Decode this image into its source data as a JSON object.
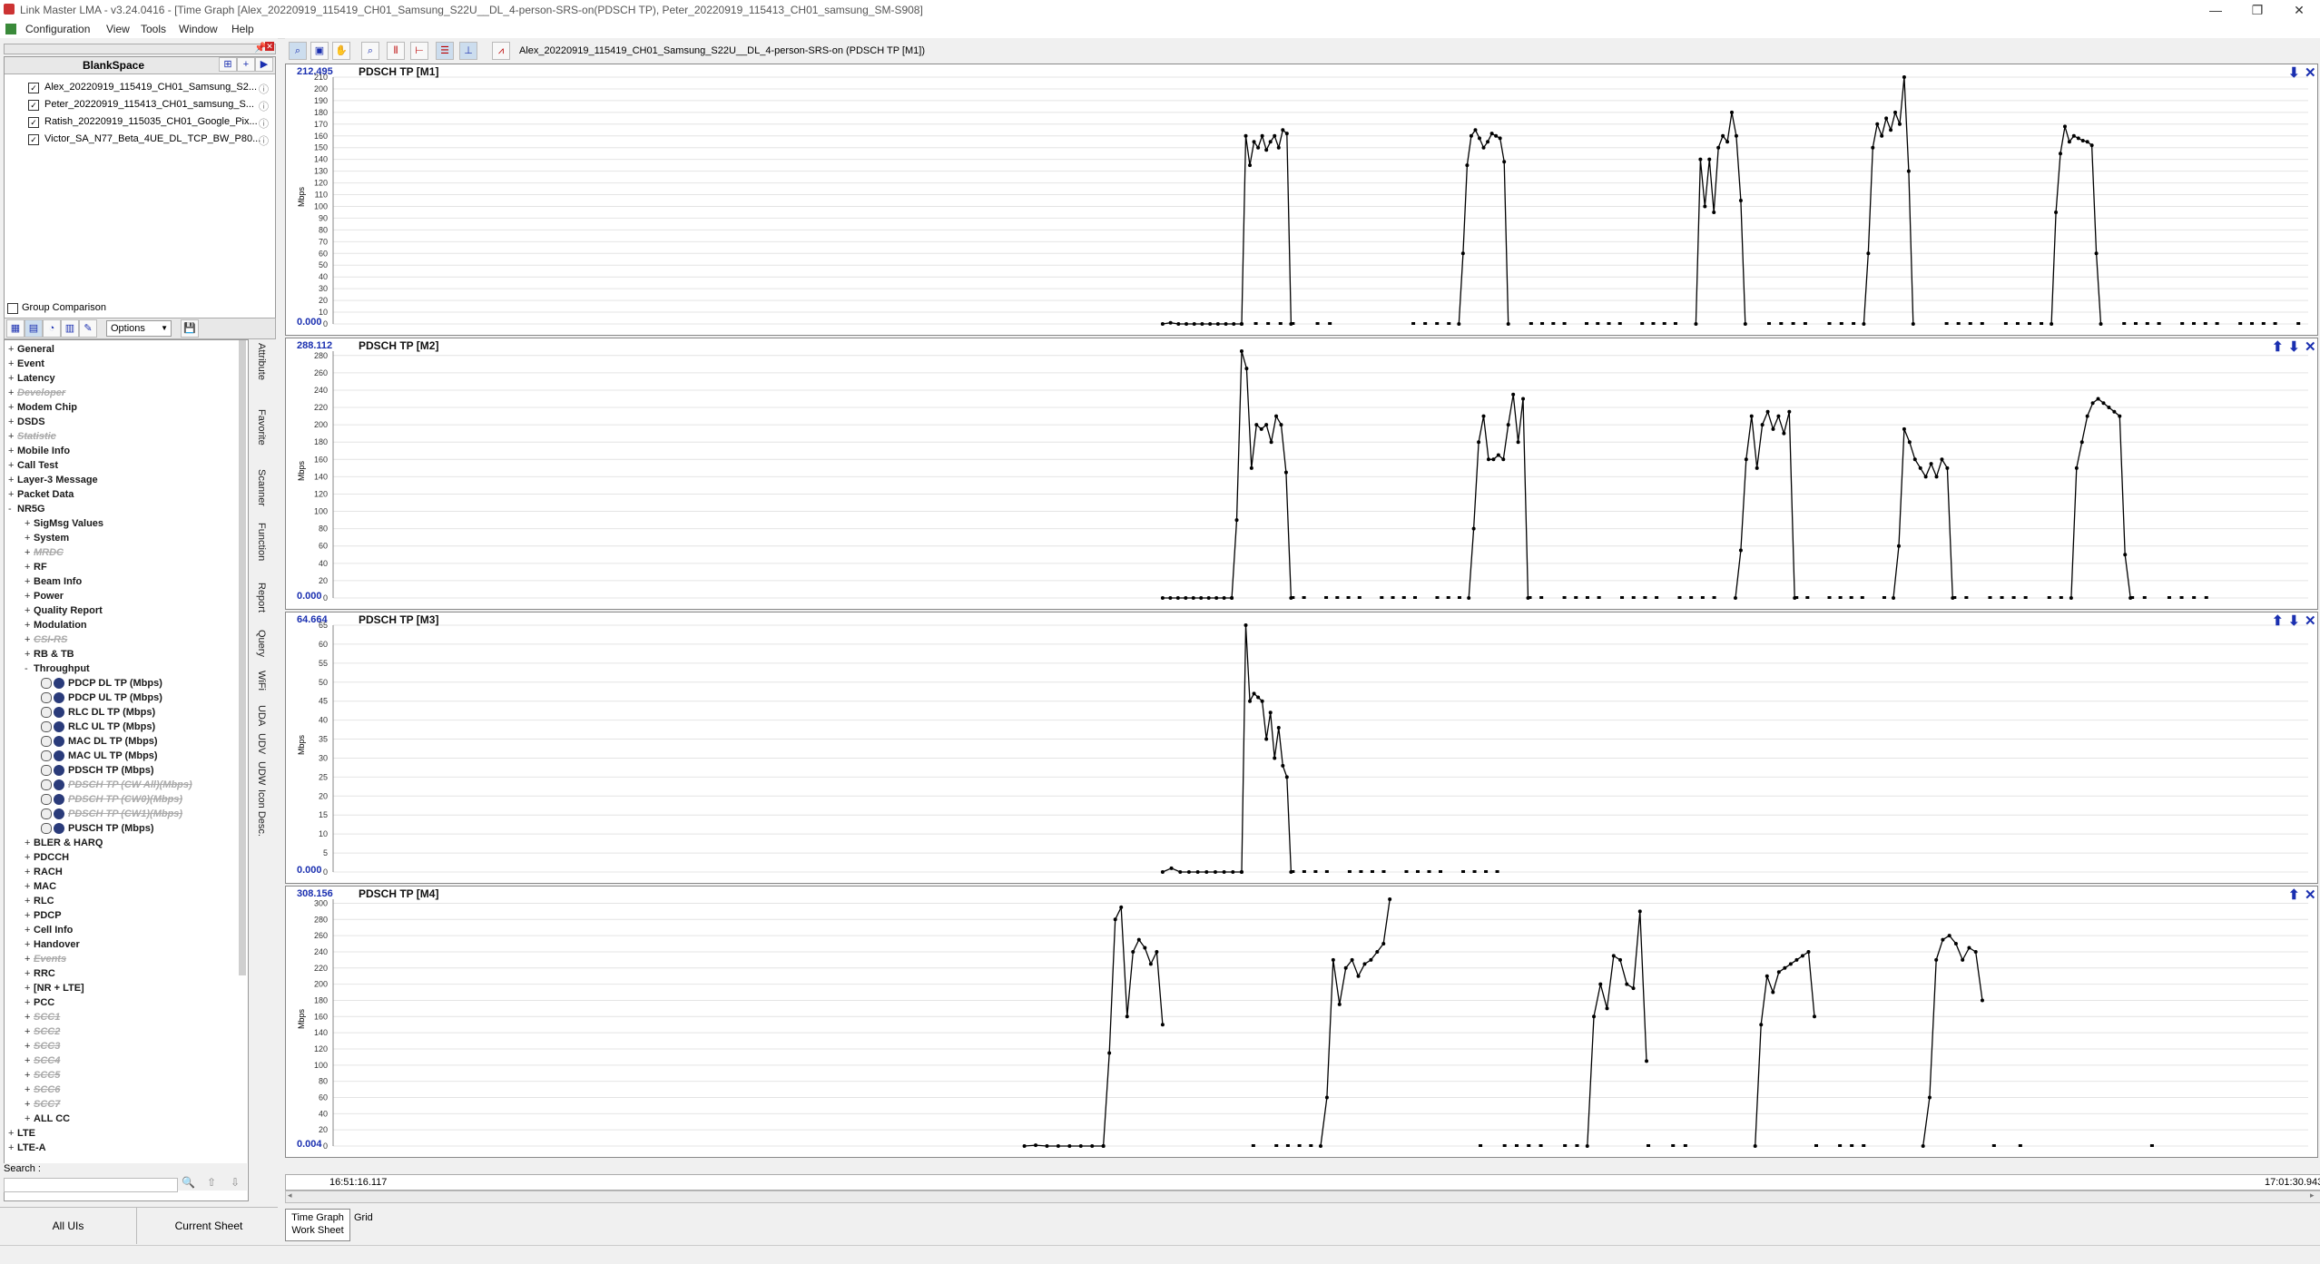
{
  "window": {
    "title": "Link Master LMA  -  v3.24.0416 - [Time Graph [Alex_20220919_115419_CH01_Samsung_S22U__DL_4-person-SRS-on(PDSCH TP), Peter_20220919_115413_CH01_samsung_SM-S908]",
    "min": "—",
    "restore": "❐",
    "close": "✕"
  },
  "menu": [
    "Configuration",
    "View",
    "Tools",
    "Window",
    "Help"
  ],
  "left": {
    "workspace": "BlankSpace",
    "logs": [
      "Alex_20220919_115419_CH01_Samsung_S2...",
      "Peter_20220919_115413_CH01_samsung_S...",
      "Ratish_20220919_115035_CH01_Google_Pix...",
      "Victor_SA_N77_Beta_4UE_DL_TCP_BW_P80..."
    ],
    "group_comparison": "Group Comparison",
    "options_label": "Options",
    "tree": [
      {
        "label": "General",
        "level": 0,
        "exp": "+"
      },
      {
        "label": "Event",
        "level": 0,
        "exp": "+"
      },
      {
        "label": "Latency",
        "level": 0,
        "exp": "+"
      },
      {
        "label": "Developer",
        "level": 0,
        "exp": "+",
        "disabled": true
      },
      {
        "label": "Modem Chip",
        "level": 0,
        "exp": "+"
      },
      {
        "label": "DSDS",
        "level": 0,
        "exp": "+"
      },
      {
        "label": "Statistic",
        "level": 0,
        "exp": "+",
        "disabled": true
      },
      {
        "label": "Mobile Info",
        "level": 0,
        "exp": "+"
      },
      {
        "label": "Call Test",
        "level": 0,
        "exp": "+"
      },
      {
        "label": "Layer-3 Message",
        "level": 0,
        "exp": "+"
      },
      {
        "label": "Packet Data",
        "level": 0,
        "exp": "+"
      },
      {
        "label": "NR5G",
        "level": 0,
        "exp": "-"
      },
      {
        "label": "SigMsg Values",
        "level": 1,
        "exp": "+"
      },
      {
        "label": "System",
        "level": 1,
        "exp": "+"
      },
      {
        "label": "MRDC",
        "level": 1,
        "exp": "+",
        "disabled": true
      },
      {
        "label": "RF",
        "level": 1,
        "exp": "+"
      },
      {
        "label": "Beam Info",
        "level": 1,
        "exp": "+"
      },
      {
        "label": "Power",
        "level": 1,
        "exp": "+"
      },
      {
        "label": "Quality Report",
        "level": 1,
        "exp": "+"
      },
      {
        "label": "Modulation",
        "level": 1,
        "exp": "+"
      },
      {
        "label": "CSI-RS",
        "level": 1,
        "exp": "+",
        "disabled": true
      },
      {
        "label": "RB & TB",
        "level": 1,
        "exp": "+"
      },
      {
        "label": "Throughput",
        "level": 1,
        "exp": "-"
      },
      {
        "label": "PDCP DL TP (Mbps)",
        "level": 2,
        "leaf": true
      },
      {
        "label": "PDCP UL TP (Mbps)",
        "level": 2,
        "leaf": true
      },
      {
        "label": "RLC DL TP (Mbps)",
        "level": 2,
        "leaf": true
      },
      {
        "label": "RLC UL TP (Mbps)",
        "level": 2,
        "leaf": true
      },
      {
        "label": "MAC DL TP (Mbps)",
        "level": 2,
        "leaf": true
      },
      {
        "label": "MAC UL TP (Mbps)",
        "level": 2,
        "leaf": true
      },
      {
        "label": "PDSCH TP (Mbps)",
        "level": 2,
        "leaf": true
      },
      {
        "label": "PDSCH TP (CW All)(Mbps)",
        "level": 2,
        "leaf": true,
        "disabled": true
      },
      {
        "label": "PDSCH TP (CW0)(Mbps)",
        "level": 2,
        "leaf": true,
        "disabled": true
      },
      {
        "label": "PDSCH TP (CW1)(Mbps)",
        "level": 2,
        "leaf": true,
        "disabled": true
      },
      {
        "label": "PUSCH TP (Mbps)",
        "level": 2,
        "leaf": true
      },
      {
        "label": "BLER & HARQ",
        "level": 1,
        "exp": "+"
      },
      {
        "label": "PDCCH",
        "level": 1,
        "exp": "+"
      },
      {
        "label": "RACH",
        "level": 1,
        "exp": "+"
      },
      {
        "label": "MAC",
        "level": 1,
        "exp": "+"
      },
      {
        "label": "RLC",
        "level": 1,
        "exp": "+"
      },
      {
        "label": "PDCP",
        "level": 1,
        "exp": "+"
      },
      {
        "label": "Cell Info",
        "level": 1,
        "exp": "+"
      },
      {
        "label": "Handover",
        "level": 1,
        "exp": "+"
      },
      {
        "label": "Events",
        "level": 1,
        "exp": "+",
        "disabled": true
      },
      {
        "label": "RRC",
        "level": 1,
        "exp": "+"
      },
      {
        "label": "[NR + LTE]",
        "level": 1,
        "exp": "+"
      },
      {
        "label": "PCC",
        "level": 1,
        "exp": "+"
      },
      {
        "label": "SCC1",
        "level": 1,
        "exp": "+",
        "disabled": true
      },
      {
        "label": "SCC2",
        "level": 1,
        "exp": "+",
        "disabled": true
      },
      {
        "label": "SCC3",
        "level": 1,
        "exp": "+",
        "disabled": true
      },
      {
        "label": "SCC4",
        "level": 1,
        "exp": "+",
        "disabled": true
      },
      {
        "label": "SCC5",
        "level": 1,
        "exp": "+",
        "disabled": true
      },
      {
        "label": "SCC6",
        "level": 1,
        "exp": "+",
        "disabled": true
      },
      {
        "label": "SCC7",
        "level": 1,
        "exp": "+",
        "disabled": true
      },
      {
        "label": "ALL CC",
        "level": 1,
        "exp": "+"
      },
      {
        "label": "LTE",
        "level": 0,
        "exp": "+"
      },
      {
        "label": "LTE-A",
        "level": 0,
        "exp": "+"
      }
    ],
    "side_tabs": [
      "Attribute",
      "Favorite",
      "Scanner",
      "Function",
      "Report",
      "Query",
      "WiFi",
      "UDA",
      "UDV",
      "UDW",
      "Icon Desc."
    ],
    "search_label": "Search :",
    "bottom_tabs": [
      "All UIs",
      "Current Sheet"
    ]
  },
  "graph": {
    "toolbar_title": "Alex_20220919_115419_CH01_Samsung_S22U__DL_4-person-SRS-on (PDSCH TP [M1])",
    "panels": [
      {
        "title": "PDSCH TP [M1]",
        "max": "212.495",
        "min": "0.000",
        "ticks": [
          210,
          200,
          190,
          180,
          170,
          160,
          150,
          140,
          130,
          120,
          110,
          100,
          90,
          80,
          70,
          60,
          50,
          40,
          30,
          20,
          10,
          0
        ],
        "ymax": 210,
        "unit": "Mbps",
        "ctrl": [
          "⬇",
          "✕"
        ],
        "segments": [
          {
            "x0": 0.42,
            "x1": 0.46,
            "pts": [
              0,
              1,
              0,
              0,
              0,
              0,
              0,
              0,
              0,
              0,
              0
            ]
          },
          {
            "x0": 0.46,
            "x1": 0.485,
            "pts": [
              0,
              160,
              135,
              155,
              150,
              160,
              148,
              155,
              160,
              150,
              165,
              162,
              0
            ]
          },
          {
            "x0": 0.57,
            "x1": 0.595,
            "pts": [
              0,
              60,
              135,
              160,
              165,
              158,
              150,
              155,
              162,
              160,
              158,
              138,
              0
            ]
          },
          {
            "x0": 0.69,
            "x1": 0.715,
            "pts": [
              0,
              140,
              100,
              140,
              95,
              150,
              160,
              155,
              180,
              160,
              105,
              0
            ]
          },
          {
            "x0": 0.775,
            "x1": 0.8,
            "pts": [
              0,
              60,
              150,
              170,
              160,
              175,
              165,
              180,
              170,
              210,
              130,
              0
            ]
          },
          {
            "x0": 0.87,
            "x1": 0.895,
            "pts": [
              0,
              95,
              145,
              168,
              155,
              160,
              158,
              156,
              155,
              152,
              60,
              0
            ]
          }
        ],
        "zero_runs": [
          [
            0.46,
            0.51
          ],
          [
            0.54,
            0.57
          ],
          [
            0.6,
            0.69
          ],
          [
            0.72,
            0.775
          ],
          [
            0.81,
            0.87
          ],
          [
            0.9,
            1.0
          ]
        ]
      },
      {
        "title": "PDSCH TP [M2]",
        "max": "288.112",
        "min": "0.000",
        "ticks": [
          280,
          260,
          240,
          220,
          200,
          180,
          160,
          140,
          120,
          100,
          80,
          60,
          40,
          20,
          0
        ],
        "ymax": 285,
        "unit": "Mbps",
        "ctrl": [
          "⬆",
          "⬇",
          "✕"
        ],
        "segments": [
          {
            "x0": 0.42,
            "x1": 0.455,
            "pts": [
              0,
              0,
              0,
              0,
              0,
              0,
              0,
              0,
              0,
              0
            ]
          },
          {
            "x0": 0.455,
            "x1": 0.485,
            "pts": [
              0,
              90,
              285,
              265,
              150,
              200,
              195,
              200,
              180,
              210,
              200,
              145,
              0
            ]
          },
          {
            "x0": 0.575,
            "x1": 0.605,
            "pts": [
              0,
              80,
              180,
              210,
              160,
              160,
              165,
              160,
              200,
              235,
              180,
              230,
              0
            ]
          },
          {
            "x0": 0.71,
            "x1": 0.74,
            "pts": [
              0,
              55,
              160,
              210,
              150,
              200,
              215,
              195,
              210,
              190,
              215,
              0
            ]
          },
          {
            "x0": 0.79,
            "x1": 0.82,
            "pts": [
              0,
              60,
              195,
              180,
              160,
              150,
              140,
              155,
              140,
              160,
              150,
              0
            ]
          },
          {
            "x0": 0.88,
            "x1": 0.91,
            "pts": [
              0,
              150,
              180,
              210,
              225,
              230,
              225,
              220,
              215,
              210,
              50,
              0
            ]
          }
        ],
        "zero_runs": [
          [
            0.485,
            0.575
          ],
          [
            0.605,
            0.71
          ],
          [
            0.74,
            0.79
          ],
          [
            0.82,
            0.88
          ],
          [
            0.91,
            0.96
          ]
        ]
      },
      {
        "title": "PDSCH TP [M3]",
        "max": "64.664",
        "min": "0.000",
        "ticks": [
          65,
          60,
          55,
          50,
          45,
          40,
          35,
          30,
          25,
          20,
          15,
          10,
          5,
          0
        ],
        "ymax": 65,
        "unit": "Mbps",
        "ctrl": [
          "⬆",
          "⬇",
          "✕"
        ],
        "segments": [
          {
            "x0": 0.42,
            "x1": 0.46,
            "pts": [
              0,
              1,
              0,
              0,
              0,
              0,
              0,
              0,
              0,
              0
            ]
          },
          {
            "x0": 0.46,
            "x1": 0.485,
            "pts": [
              0,
              65,
              45,
              47,
              46,
              45,
              35,
              42,
              30,
              38,
              28,
              25,
              0
            ]
          }
        ],
        "zero_runs": [
          [
            0.485,
            0.6
          ]
        ]
      },
      {
        "title": "PDSCH TP [M4]",
        "max": "308.156",
        "min": "0.004",
        "ticks": [
          300,
          280,
          260,
          240,
          220,
          200,
          180,
          160,
          140,
          120,
          100,
          80,
          60,
          40,
          20,
          0
        ],
        "ymax": 305,
        "unit": "Mbps",
        "ctrl": [
          "⬆",
          "✕"
        ],
        "segments": [
          {
            "x0": 0.35,
            "x1": 0.39,
            "pts": [
              0,
              1,
              0,
              0,
              0,
              0,
              0,
              0
            ]
          },
          {
            "x0": 0.39,
            "x1": 0.42,
            "pts": [
              0,
              115,
              280,
              295,
              160,
              240,
              255,
              245,
              225,
              240,
              150
            ]
          },
          {
            "x0": 0.5,
            "x1": 0.535,
            "pts": [
              0,
              60,
              230,
              175,
              220,
              230,
              210,
              225,
              230,
              240,
              250,
              305
            ]
          },
          {
            "x0": 0.635,
            "x1": 0.665,
            "pts": [
              0,
              160,
              200,
              170,
              235,
              230,
              200,
              195,
              290,
              105
            ]
          },
          {
            "x0": 0.72,
            "x1": 0.75,
            "pts": [
              0,
              150,
              210,
              190,
              215,
              220,
              225,
              230,
              235,
              240,
              160
            ]
          },
          {
            "x0": 0.805,
            "x1": 0.835,
            "pts": [
              0,
              60,
              230,
              255,
              260,
              250,
              230,
              245,
              240,
              180
            ]
          }
        ],
        "zero_runs": [
          [
            0.465,
            0.5
          ],
          [
            0.58,
            0.635
          ],
          [
            0.665,
            0.69
          ],
          [
            0.75,
            0.78
          ],
          [
            0.84,
            0.86
          ],
          [
            0.92,
            0.93
          ]
        ]
      }
    ],
    "time_start": "16:51:16.117",
    "time_end": "17:01:30.943",
    "sheet_tabs": [
      "Time Graph\nWork Sheet",
      "Grid"
    ]
  }
}
